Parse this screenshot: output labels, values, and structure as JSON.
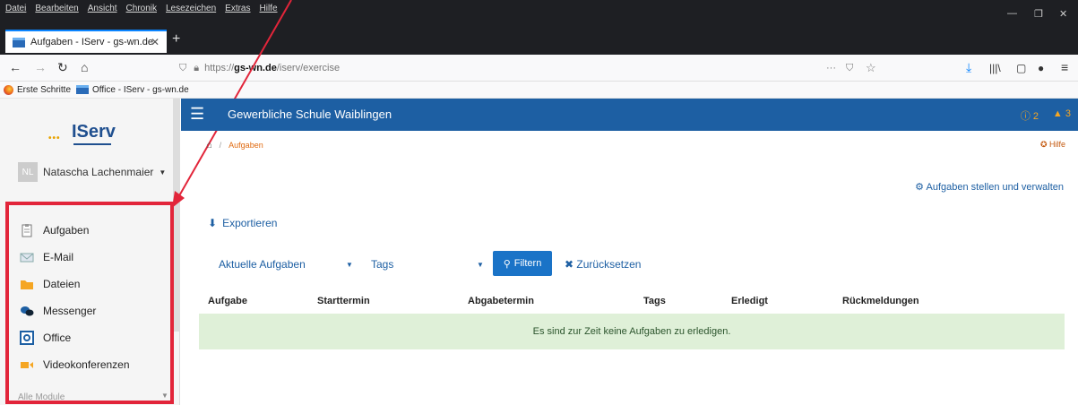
{
  "browser": {
    "menus": [
      "Datei",
      "Bearbeiten",
      "Ansicht",
      "Chronik",
      "Lesezeichen",
      "Extras",
      "Hilfe"
    ],
    "tab_title": "Aufgaben - IServ - gs-wn.de",
    "url_prefix": "https://",
    "url_domain": "gs-wn.de",
    "url_path": "/iserv/exercise",
    "bookmarks": [
      "Erste Schritte",
      "Office - IServ - gs-wn.de"
    ]
  },
  "sidebar": {
    "logo": "IServ",
    "user_initials": "NL",
    "user_name": "Natascha Lachenmaier",
    "items": [
      {
        "label": "Aufgaben",
        "icon": "clipboard-icon"
      },
      {
        "label": "E-Mail",
        "icon": "envelope-icon"
      },
      {
        "label": "Dateien",
        "icon": "folder-icon"
      },
      {
        "label": "Messenger",
        "icon": "chat-bubbles-icon"
      },
      {
        "label": "Office",
        "icon": "office-icon"
      },
      {
        "label": "Videokonferenzen",
        "icon": "video-camera-icon"
      }
    ],
    "all_modules": "Alle Module"
  },
  "header": {
    "school": "Gewerbliche Schule Waiblingen",
    "notifications": "2",
    "alerts": "3"
  },
  "breadcrumb": {
    "current": "Aufgaben"
  },
  "help": "Hilfe",
  "manage_link": "Aufgaben stellen und verwalten",
  "export": "Exportieren",
  "filters": {
    "status_select": "Aktuelle Aufgaben",
    "tags_select": "Tags",
    "filter_button": "Filtern",
    "reset": "Zurücksetzen"
  },
  "table": {
    "columns": [
      "Aufgabe",
      "Starttermin",
      "Abgabetermin",
      "Tags",
      "Erledigt",
      "Rückmeldungen"
    ],
    "empty": "Es sind zur Zeit keine Aufgaben zu erledigen."
  },
  "colors": {
    "header": "#1d5fa3",
    "highlight": "#e2253a",
    "empty_row": "#dff0d8"
  }
}
